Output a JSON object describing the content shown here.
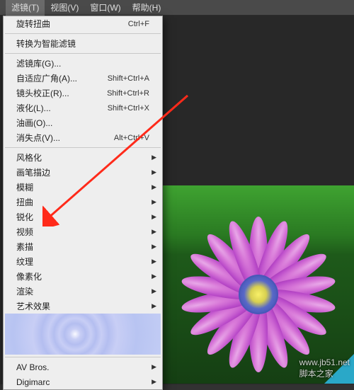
{
  "menubar": {
    "items": [
      {
        "label": "滤镜(T)",
        "active": true
      },
      {
        "label": "视图(V)",
        "active": false
      },
      {
        "label": "窗口(W)",
        "active": false
      },
      {
        "label": "帮助(H)",
        "active": false
      }
    ]
  },
  "dropdown": {
    "group1": [
      {
        "label": "旋转扭曲",
        "shortcut": "Ctrl+F"
      }
    ],
    "group2": [
      {
        "label": "转换为智能滤镜"
      }
    ],
    "group3": [
      {
        "label": "滤镜库(G)..."
      },
      {
        "label": "自适应广角(A)...",
        "shortcut": "Shift+Ctrl+A"
      },
      {
        "label": "镜头校正(R)...",
        "shortcut": "Shift+Ctrl+R"
      },
      {
        "label": "液化(L)...",
        "shortcut": "Shift+Ctrl+X"
      },
      {
        "label": "油画(O)..."
      },
      {
        "label": "消失点(V)...",
        "shortcut": "Alt+Ctrl+V"
      }
    ],
    "group4": [
      {
        "label": "风格化",
        "sub": true
      },
      {
        "label": "画笔描边",
        "sub": true
      },
      {
        "label": "模糊",
        "sub": true
      },
      {
        "label": "扭曲",
        "sub": true
      },
      {
        "label": "锐化",
        "sub": true
      },
      {
        "label": "视频",
        "sub": true
      },
      {
        "label": "素描",
        "sub": true
      },
      {
        "label": "纹理",
        "sub": true
      },
      {
        "label": "像素化",
        "sub": true
      },
      {
        "label": "渲染",
        "sub": true
      },
      {
        "label": "艺术效果",
        "sub": true
      }
    ],
    "group5": [
      {
        "label": "AV Bros.",
        "sub": true
      },
      {
        "label": "Digimarc",
        "sub": true
      }
    ]
  },
  "watermark": {
    "line1": "www.jb51.net",
    "line2": "脚本之家"
  },
  "colors": {
    "accent_arrow": "#ff2a1a"
  }
}
